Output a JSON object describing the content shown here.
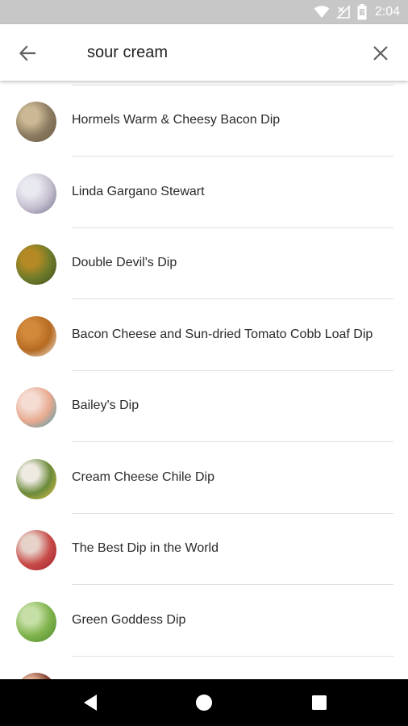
{
  "status_bar": {
    "time": "2:04",
    "icons": [
      "wifi-icon",
      "no-signal-icon",
      "battery-icon"
    ]
  },
  "search": {
    "query": "sour cream",
    "back_icon": "arrow-back-icon",
    "clear_icon": "close-icon"
  },
  "results": [
    {
      "title": "Hormels Warm & Cheesy Bacon Dip",
      "thumb_colors": [
        "#6b5a44",
        "#cbb894",
        "#8a7a5f"
      ]
    },
    {
      "title": "Linda Gargano Stewart",
      "thumb_colors": [
        "#6d6f8c",
        "#e9e9f0",
        "#c7c0d0"
      ]
    },
    {
      "title": "Double Devil's Dip",
      "thumb_colors": [
        "#3c4a1e",
        "#b58a25",
        "#6e7b2a"
      ]
    },
    {
      "title": "Bacon Cheese and Sun-dried Tomato Cobb Loaf Dip",
      "thumb_colors": [
        "#f3efe9",
        "#d2893a",
        "#b56a22"
      ]
    },
    {
      "title": "Bailey's Dip",
      "thumb_colors": [
        "#2f9fb2",
        "#f5dcd2",
        "#e7a98f"
      ]
    },
    {
      "title": "Cream Cheese Chile Dip",
      "thumb_colors": [
        "#e2c24a",
        "#eeeae2",
        "#6c8b3b"
      ]
    },
    {
      "title": "The Best Dip in the World",
      "thumb_colors": [
        "#9f1d27",
        "#e6d2c8",
        "#c84c4a"
      ]
    },
    {
      "title": "Green Goddess Dip",
      "thumb_colors": [
        "#4d8a2d",
        "#c5dfa6",
        "#7fb24b"
      ]
    },
    {
      "title": "",
      "thumb_colors": [
        "#b24b3a",
        "#e6b69a",
        "#7a3a2a"
      ]
    }
  ],
  "nav_bar": {
    "back_icon": "nav-back-icon",
    "home_icon": "nav-home-icon",
    "recents_icon": "nav-recents-icon"
  }
}
